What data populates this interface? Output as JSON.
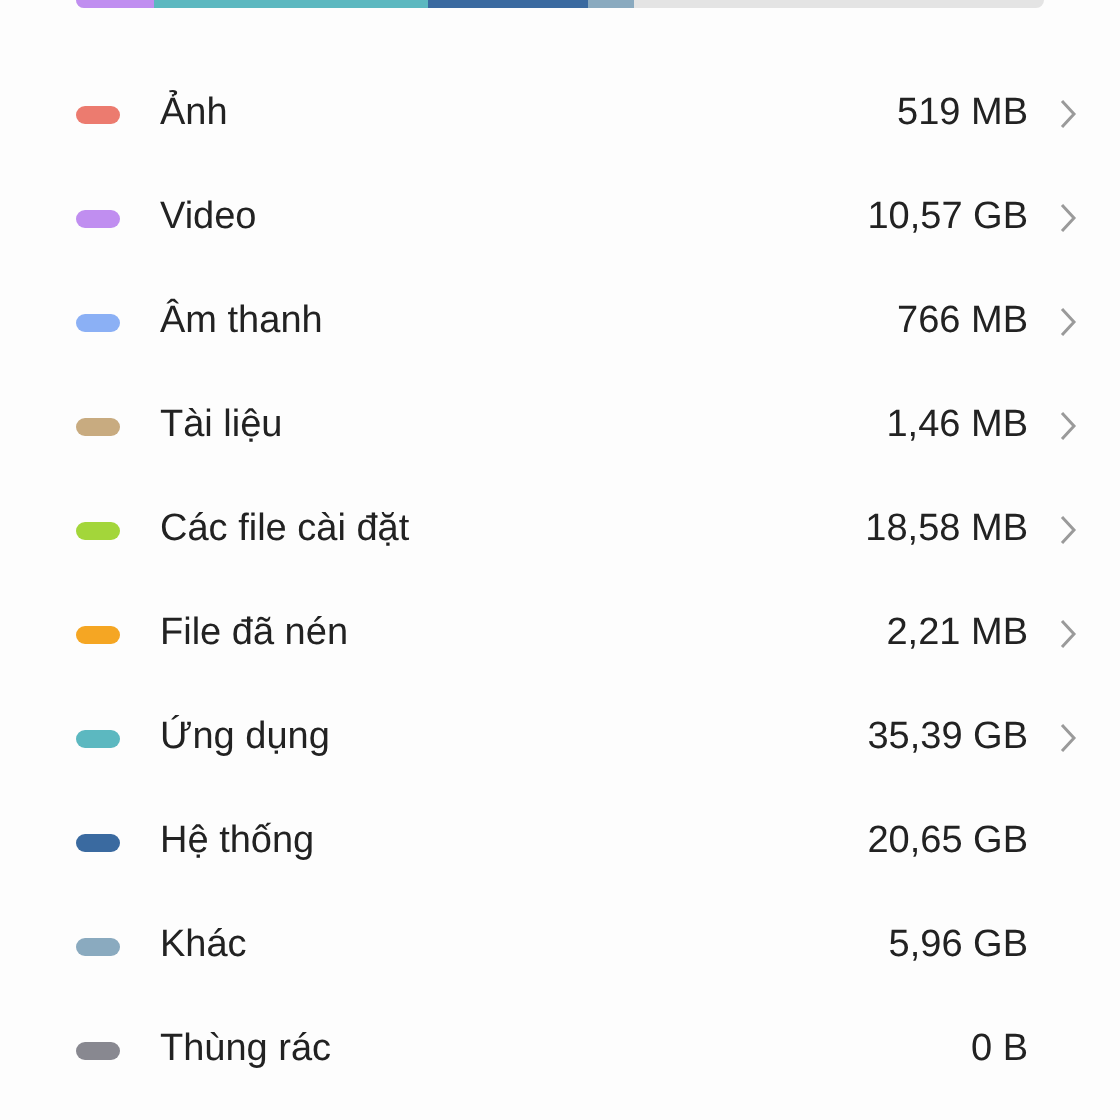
{
  "categories": [
    {
      "name": "Ảnh",
      "size": "519 MB",
      "color": "#ec7b6f",
      "navigable": true
    },
    {
      "name": "Video",
      "size": "10,57 GB",
      "color": "#c08ef0",
      "navigable": true
    },
    {
      "name": "Âm thanh",
      "size": "766 MB",
      "color": "#8bb0f5",
      "navigable": true
    },
    {
      "name": "Tài liệu",
      "size": "1,46 MB",
      "color": "#c8ab80",
      "navigable": true
    },
    {
      "name": "Các file cài đặt",
      "size": "18,58 MB",
      "color": "#a3d63a",
      "navigable": true
    },
    {
      "name": "File đã nén",
      "size": "2,21 MB",
      "color": "#f5a623",
      "navigable": true
    },
    {
      "name": "Ứng dụng",
      "size": "35,39 GB",
      "color": "#5cb8c0",
      "navigable": true
    },
    {
      "name": "Hệ thống",
      "size": "20,65 GB",
      "color": "#3a6aa0",
      "navigable": false
    },
    {
      "name": "Khác",
      "size": "5,96 GB",
      "color": "#8aaabf",
      "navigable": false
    },
    {
      "name": "Thùng rác",
      "size": "0 B",
      "color": "#888890",
      "navigable": false
    }
  ]
}
